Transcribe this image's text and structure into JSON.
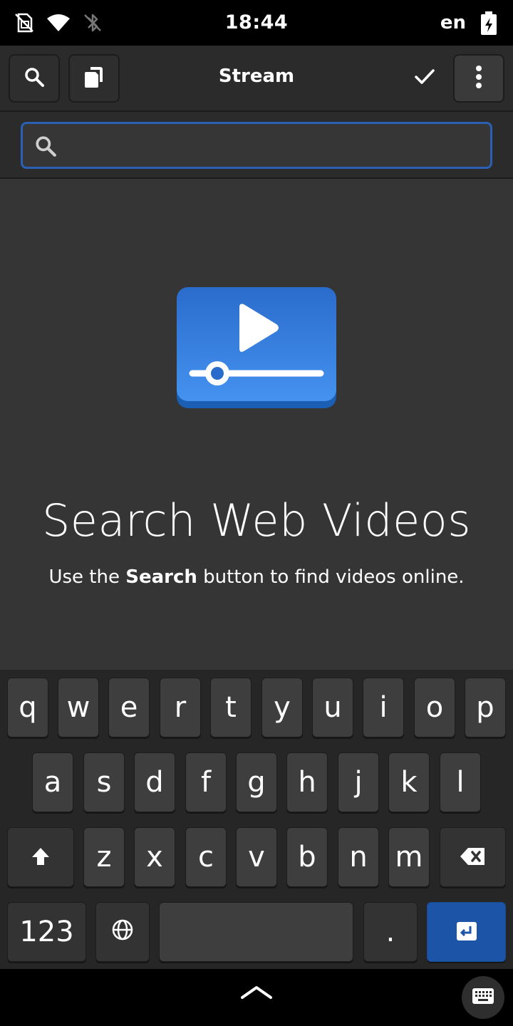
{
  "status_bar": {
    "time": "18:44",
    "language": "en",
    "icons": [
      "no-sim-icon",
      "wifi-icon",
      "bluetooth-disabled-icon",
      "battery-charging-icon"
    ]
  },
  "header": {
    "title": "Stream",
    "buttons": [
      "search-icon",
      "copy-icon",
      "check-icon",
      "menu-icon"
    ]
  },
  "search": {
    "value": "",
    "placeholder": ""
  },
  "empty_state": {
    "title": "Search Web Videos",
    "desc_prefix": "Use the ",
    "desc_bold": "Search",
    "desc_suffix": " button to find videos online."
  },
  "keyboard": {
    "row1": [
      "q",
      "w",
      "e",
      "r",
      "t",
      "y",
      "u",
      "i",
      "o",
      "p"
    ],
    "row2": [
      "a",
      "s",
      "d",
      "f",
      "g",
      "h",
      "j",
      "k",
      "l"
    ],
    "row3": [
      "z",
      "x",
      "c",
      "v",
      "b",
      "n",
      "m"
    ],
    "numbers_label": "123",
    "period_label": ".",
    "special_icons": [
      "shift-icon",
      "backspace-icon",
      "globe-icon",
      "enter-icon"
    ]
  },
  "colors": {
    "accent": "#1c55a8",
    "entry_focus": "#2a5fb3",
    "background": "#353535",
    "headerbar": "#2b2b2b",
    "app_icon_blue": "#3584e4"
  }
}
